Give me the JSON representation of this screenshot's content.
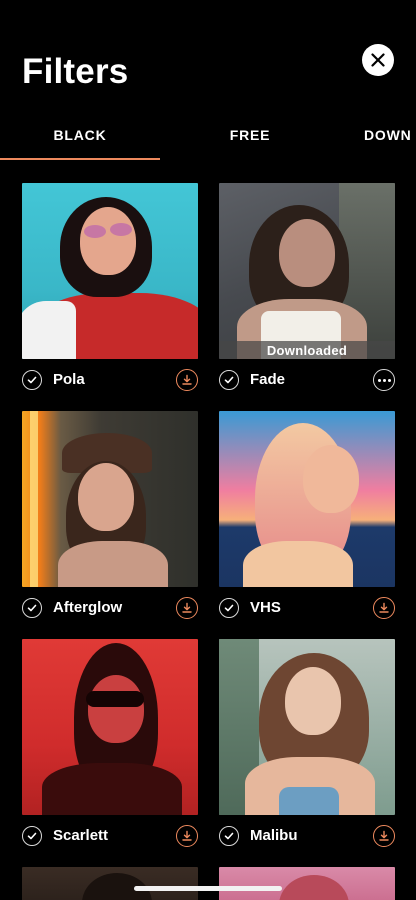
{
  "header": {
    "title": "Filters"
  },
  "tabs": [
    {
      "label": "BLACK",
      "active": true
    },
    {
      "label": "FREE",
      "active": false
    },
    {
      "label": "DOWN",
      "active": false
    }
  ],
  "accent_color": "#ee8a5e",
  "filters": [
    {
      "name": "Pola",
      "status_text": "",
      "action": "download",
      "palette": [
        "#3fc1d1",
        "#c62a2a",
        "#1c1010",
        "#e7b8a4"
      ]
    },
    {
      "name": "Fade",
      "status_text": "Downloaded",
      "action": "more",
      "palette": [
        "#4d5055",
        "#f2efe8",
        "#3a2a22",
        "#b99485"
      ]
    },
    {
      "name": "Afterglow",
      "status_text": "",
      "action": "download",
      "palette": [
        "#3c3a34",
        "#f0a020",
        "#4a3024",
        "#d9a58e"
      ]
    },
    {
      "name": "VHS",
      "status_text": "",
      "action": "download",
      "palette": [
        "#1e3d6e",
        "#e76a75",
        "#f0c2a0",
        "#e98a8a"
      ]
    },
    {
      "name": "Scarlett",
      "status_text": "",
      "action": "download",
      "palette": [
        "#d93232",
        "#3a0c0c",
        "#1a0606",
        "#c43a3a"
      ]
    },
    {
      "name": "Malibu",
      "status_text": "",
      "action": "download",
      "palette": [
        "#9ab0a6",
        "#6c9ec2",
        "#6e4632",
        "#e9c5ad"
      ]
    }
  ]
}
